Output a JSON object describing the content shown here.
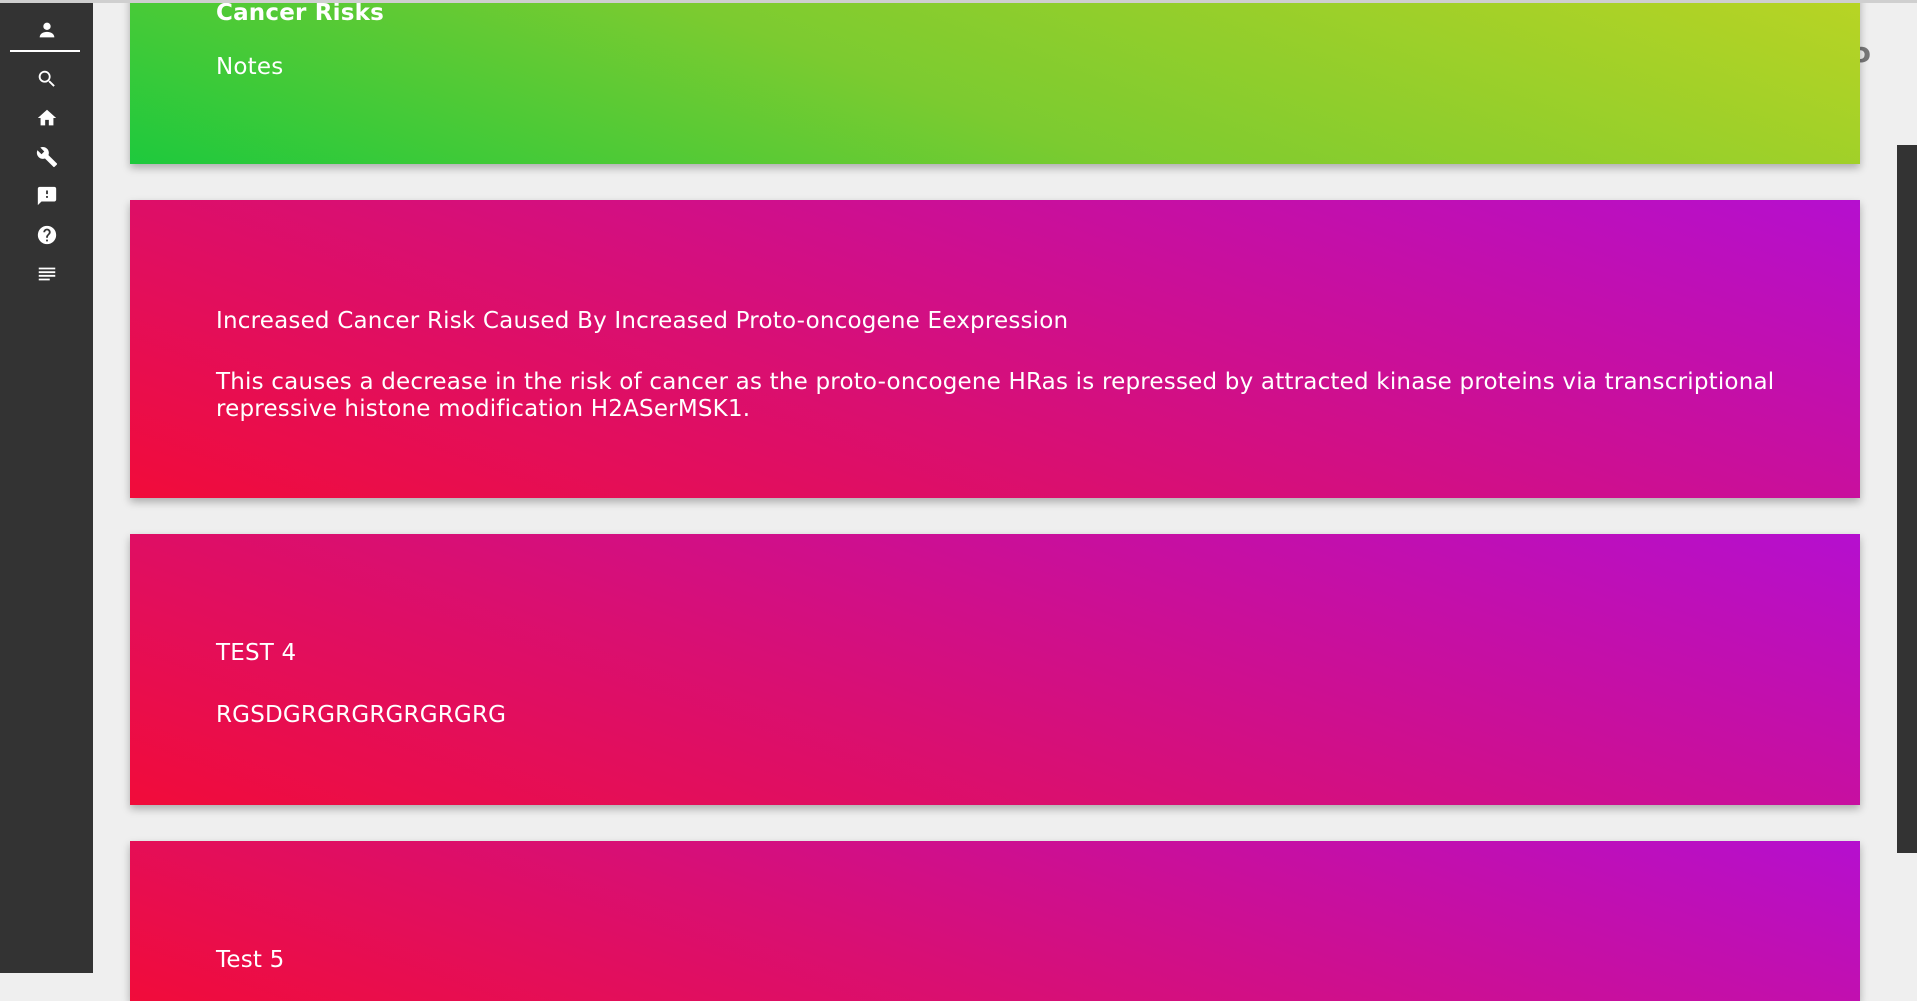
{
  "sidebar": {
    "items": [
      {
        "name": "account",
        "icon": "person-icon"
      },
      {
        "name": "search",
        "icon": "search-icon"
      },
      {
        "name": "home",
        "icon": "home-icon"
      },
      {
        "name": "tools",
        "icon": "wrench-icon"
      },
      {
        "name": "feedback",
        "icon": "feedback-icon"
      },
      {
        "name": "help",
        "icon": "help-icon"
      },
      {
        "name": "notes",
        "icon": "notes-icon"
      }
    ]
  },
  "cards": [
    {
      "title": "Cancer Risks",
      "body": "Notes",
      "color": "#7ccb30"
    },
    {
      "title": "Increased Cancer Risk Caused By Increased Proto-oncogene Eexpression",
      "body": "This causes a decrease in the risk of cancer as the proto-oncogene HRas is repressed by attracted kinase proteins via transcriptional repressive histone modification H2ASerMSK1.",
      "color": "#d90f72"
    },
    {
      "title": "TEST 4",
      "body": "RGSDGRGRGRGRGRGRG",
      "color": "#d90f72"
    },
    {
      "title": "Test 5",
      "body": "",
      "color": "#d90f72"
    }
  ],
  "colors": {
    "sidebar": "#333333",
    "background": "#efefef",
    "green_card": "#7ccb30",
    "pink_card": "#d90f72"
  }
}
